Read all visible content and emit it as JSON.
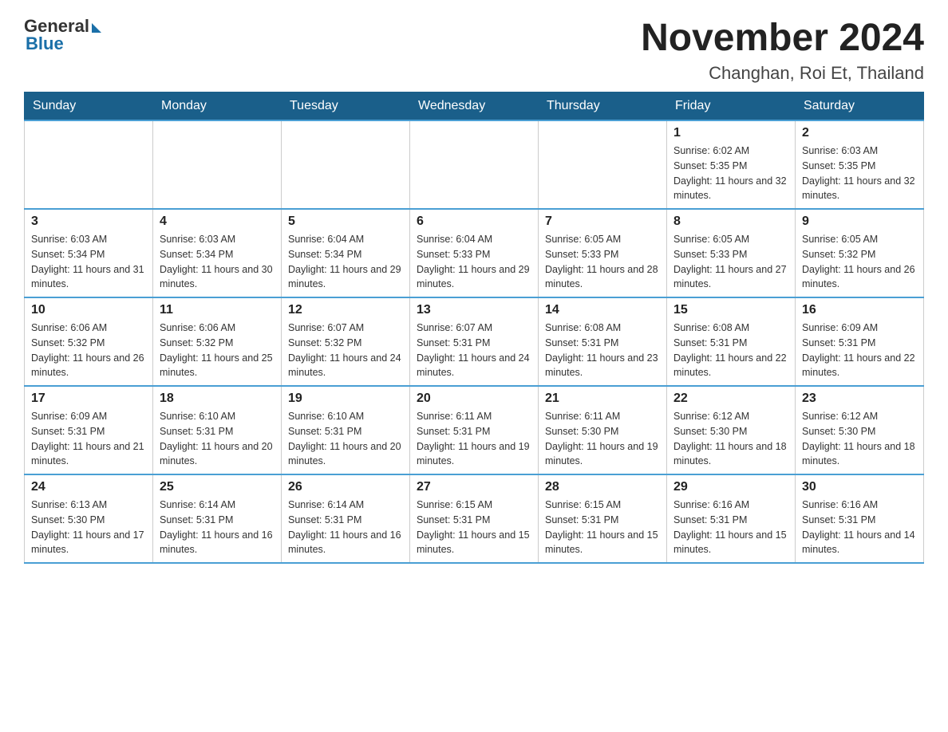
{
  "header": {
    "logo_general": "General",
    "logo_blue": "Blue",
    "month_title": "November 2024",
    "location": "Changhan, Roi Et, Thailand"
  },
  "days_of_week": [
    "Sunday",
    "Monday",
    "Tuesday",
    "Wednesday",
    "Thursday",
    "Friday",
    "Saturday"
  ],
  "weeks": [
    [
      null,
      null,
      null,
      null,
      null,
      {
        "day": "1",
        "sunrise": "Sunrise: 6:02 AM",
        "sunset": "Sunset: 5:35 PM",
        "daylight": "Daylight: 11 hours and 32 minutes."
      },
      {
        "day": "2",
        "sunrise": "Sunrise: 6:03 AM",
        "sunset": "Sunset: 5:35 PM",
        "daylight": "Daylight: 11 hours and 32 minutes."
      }
    ],
    [
      {
        "day": "3",
        "sunrise": "Sunrise: 6:03 AM",
        "sunset": "Sunset: 5:34 PM",
        "daylight": "Daylight: 11 hours and 31 minutes."
      },
      {
        "day": "4",
        "sunrise": "Sunrise: 6:03 AM",
        "sunset": "Sunset: 5:34 PM",
        "daylight": "Daylight: 11 hours and 30 minutes."
      },
      {
        "day": "5",
        "sunrise": "Sunrise: 6:04 AM",
        "sunset": "Sunset: 5:34 PM",
        "daylight": "Daylight: 11 hours and 29 minutes."
      },
      {
        "day": "6",
        "sunrise": "Sunrise: 6:04 AM",
        "sunset": "Sunset: 5:33 PM",
        "daylight": "Daylight: 11 hours and 29 minutes."
      },
      {
        "day": "7",
        "sunrise": "Sunrise: 6:05 AM",
        "sunset": "Sunset: 5:33 PM",
        "daylight": "Daylight: 11 hours and 28 minutes."
      },
      {
        "day": "8",
        "sunrise": "Sunrise: 6:05 AM",
        "sunset": "Sunset: 5:33 PM",
        "daylight": "Daylight: 11 hours and 27 minutes."
      },
      {
        "day": "9",
        "sunrise": "Sunrise: 6:05 AM",
        "sunset": "Sunset: 5:32 PM",
        "daylight": "Daylight: 11 hours and 26 minutes."
      }
    ],
    [
      {
        "day": "10",
        "sunrise": "Sunrise: 6:06 AM",
        "sunset": "Sunset: 5:32 PM",
        "daylight": "Daylight: 11 hours and 26 minutes."
      },
      {
        "day": "11",
        "sunrise": "Sunrise: 6:06 AM",
        "sunset": "Sunset: 5:32 PM",
        "daylight": "Daylight: 11 hours and 25 minutes."
      },
      {
        "day": "12",
        "sunrise": "Sunrise: 6:07 AM",
        "sunset": "Sunset: 5:32 PM",
        "daylight": "Daylight: 11 hours and 24 minutes."
      },
      {
        "day": "13",
        "sunrise": "Sunrise: 6:07 AM",
        "sunset": "Sunset: 5:31 PM",
        "daylight": "Daylight: 11 hours and 24 minutes."
      },
      {
        "day": "14",
        "sunrise": "Sunrise: 6:08 AM",
        "sunset": "Sunset: 5:31 PM",
        "daylight": "Daylight: 11 hours and 23 minutes."
      },
      {
        "day": "15",
        "sunrise": "Sunrise: 6:08 AM",
        "sunset": "Sunset: 5:31 PM",
        "daylight": "Daylight: 11 hours and 22 minutes."
      },
      {
        "day": "16",
        "sunrise": "Sunrise: 6:09 AM",
        "sunset": "Sunset: 5:31 PM",
        "daylight": "Daylight: 11 hours and 22 minutes."
      }
    ],
    [
      {
        "day": "17",
        "sunrise": "Sunrise: 6:09 AM",
        "sunset": "Sunset: 5:31 PM",
        "daylight": "Daylight: 11 hours and 21 minutes."
      },
      {
        "day": "18",
        "sunrise": "Sunrise: 6:10 AM",
        "sunset": "Sunset: 5:31 PM",
        "daylight": "Daylight: 11 hours and 20 minutes."
      },
      {
        "day": "19",
        "sunrise": "Sunrise: 6:10 AM",
        "sunset": "Sunset: 5:31 PM",
        "daylight": "Daylight: 11 hours and 20 minutes."
      },
      {
        "day": "20",
        "sunrise": "Sunrise: 6:11 AM",
        "sunset": "Sunset: 5:31 PM",
        "daylight": "Daylight: 11 hours and 19 minutes."
      },
      {
        "day": "21",
        "sunrise": "Sunrise: 6:11 AM",
        "sunset": "Sunset: 5:30 PM",
        "daylight": "Daylight: 11 hours and 19 minutes."
      },
      {
        "day": "22",
        "sunrise": "Sunrise: 6:12 AM",
        "sunset": "Sunset: 5:30 PM",
        "daylight": "Daylight: 11 hours and 18 minutes."
      },
      {
        "day": "23",
        "sunrise": "Sunrise: 6:12 AM",
        "sunset": "Sunset: 5:30 PM",
        "daylight": "Daylight: 11 hours and 18 minutes."
      }
    ],
    [
      {
        "day": "24",
        "sunrise": "Sunrise: 6:13 AM",
        "sunset": "Sunset: 5:30 PM",
        "daylight": "Daylight: 11 hours and 17 minutes."
      },
      {
        "day": "25",
        "sunrise": "Sunrise: 6:14 AM",
        "sunset": "Sunset: 5:31 PM",
        "daylight": "Daylight: 11 hours and 16 minutes."
      },
      {
        "day": "26",
        "sunrise": "Sunrise: 6:14 AM",
        "sunset": "Sunset: 5:31 PM",
        "daylight": "Daylight: 11 hours and 16 minutes."
      },
      {
        "day": "27",
        "sunrise": "Sunrise: 6:15 AM",
        "sunset": "Sunset: 5:31 PM",
        "daylight": "Daylight: 11 hours and 15 minutes."
      },
      {
        "day": "28",
        "sunrise": "Sunrise: 6:15 AM",
        "sunset": "Sunset: 5:31 PM",
        "daylight": "Daylight: 11 hours and 15 minutes."
      },
      {
        "day": "29",
        "sunrise": "Sunrise: 6:16 AM",
        "sunset": "Sunset: 5:31 PM",
        "daylight": "Daylight: 11 hours and 15 minutes."
      },
      {
        "day": "30",
        "sunrise": "Sunrise: 6:16 AM",
        "sunset": "Sunset: 5:31 PM",
        "daylight": "Daylight: 11 hours and 14 minutes."
      }
    ]
  ]
}
